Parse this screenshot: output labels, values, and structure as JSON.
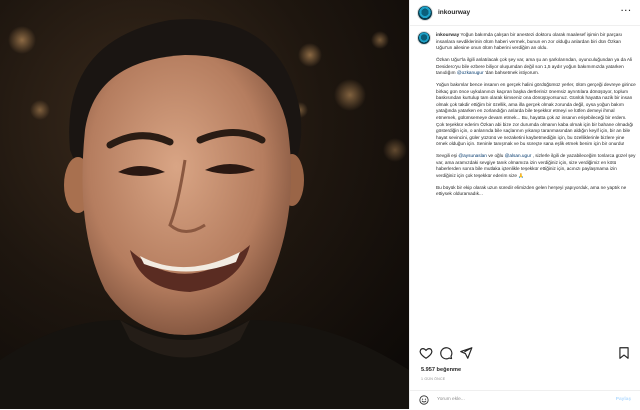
{
  "post": {
    "username": "inkourway",
    "caption_username": "inkourway",
    "paragraphs": [
      "Yoğun bakımda çalışan bir anestezi doktoru olarak maalesef işimin bir parçası insanlara sevdiklerinin ölüm haberi vermek, bunun en zor olduğu anlardan biri dün Özkan Uğur'un ailesine onun ölüm haberini verdiğim an oldu.",
      "Özkan Uğur'la ilgili anlatılacak çok şey var, ama şu an şarkılarından, oyunculuğundan ya da Ali Desidero'yu bile ezbere biliyor oluşumdan değil son 1,5 aydır yoğun bakımımızda yatarken tanıdığım @ozkanugur 'dan bahsetmek istiyorum.",
      "Yoğun bakımlar bence insanın en gerçek halini gördüğümüz yerler, ölüm gerçeği devreye girince birkaç gün önce uykulanınızı kaçıran başka dertleriniz önemsiz ayrıntılara dönüşüyor, toplum baskısından kurtulup tam olarak kimseniz ona dönüşüyorsunuz. Günlük hayatta nazik bir insan olmak çok takdir ettiğim bir özellik, ama illa gerçek olmak zorunda değil, oysa yoğun bakım yatağında yatarken en zorlandığın anlarda bile teşekkür etmeyi ve lütfen demeyi ihmal etmemek, gülümsemeye devam etmek... Bu, hayatta çok az insanın erişebileceği bir erdem. Çok teşekkür ederim Özkan abi bize zor durumda olmanın kaba olmak için bir bahane olmadığı gösterdiğin için, o anlarında bile saçlarının yıkanıp taranmasından aldığın keyif için, bir an bile hayat sevincini, güler yüzünü ve nezaketini kaybetmediğin için, bu özelliklerinle bizlere yine örnek olduğun için. Seninle tanışmak ve bu süreçte sana eşlik etmek benim için bir onurdu!",
      "Sevgili eşi @aysunaslan ve oğlu @alsan.ugur , sizlerle ilgili de yazabileceğim tonlarca güzel şey var, ama aramızdaki sevgiye tanık olmamıza izin verdiğiniz için, size verdiğimiz en kötü haberlerden sonra bile mutlaka içtenlikle teşekkür ettiğiniz için, acınızı paylaşmama izin verdiğiniz için çok teşekkür ederim size 🙏",
      "Bu büyük bir ekip olarak uzun süredir elimizden gelen herşeyi yapıyorduk, ama ne yaptık ne ettiysek olduramadık..."
    ],
    "likes_text": "5.957 beğenme",
    "date_text": "1 GÜN ÖNCE",
    "comment_placeholder": "Yorum ekle...",
    "share_label": "Paylaş"
  },
  "icons": {
    "more": "more-options-icon",
    "like": "heart-icon",
    "comment": "comment-icon",
    "share": "send-icon",
    "save": "bookmark-icon",
    "emoji": "emoji-icon"
  },
  "colors": {
    "mention": "#00376b",
    "border": "#efefef",
    "muted": "#8e8e8e",
    "share_disabled": "#b3dbff"
  }
}
